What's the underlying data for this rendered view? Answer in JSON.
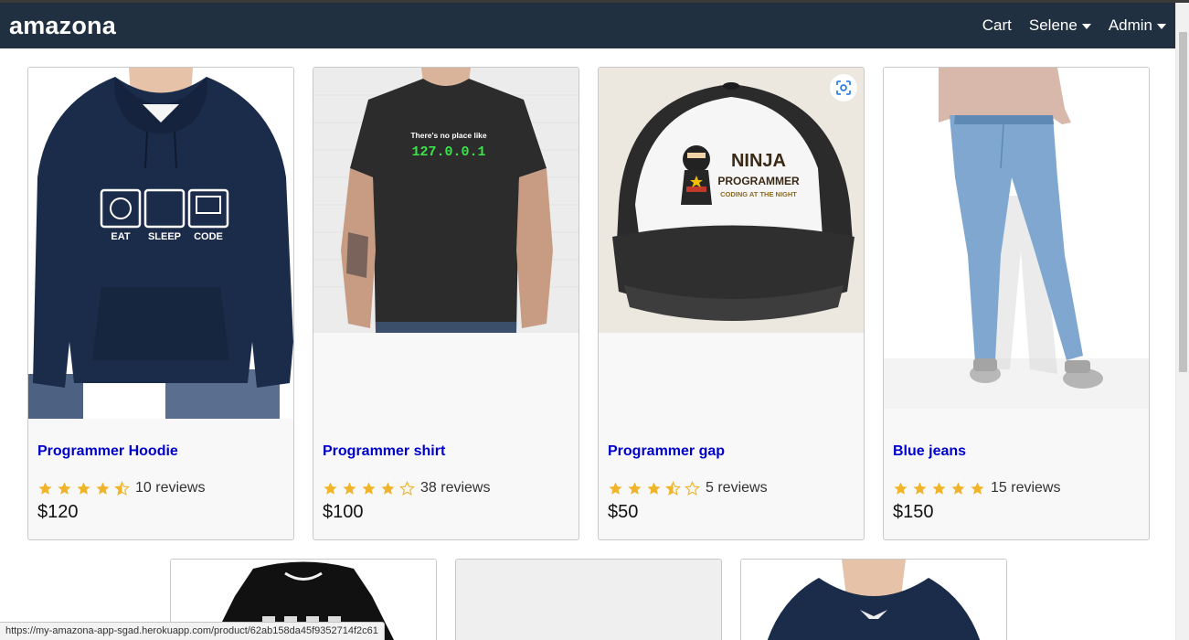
{
  "header": {
    "brand": "amazona",
    "cart_label": "Cart",
    "user_label": "Selene",
    "admin_label": "Admin"
  },
  "colors": {
    "header_bg": "#203040",
    "link": "#0000cc",
    "star": "#f0b429"
  },
  "products": [
    {
      "name": "Programmer Hoodie",
      "rating": 4.5,
      "reviews": "10 reviews",
      "price": "$120"
    },
    {
      "name": "Programmer shirt",
      "rating": 4,
      "reviews": "38 reviews",
      "price": "$100"
    },
    {
      "name": "Programmer gap",
      "rating": 3.5,
      "reviews": "5 reviews",
      "price": "$50"
    },
    {
      "name": "Blue jeans",
      "rating": 5,
      "reviews": "15 reviews",
      "price": "$150"
    }
  ],
  "artwork": {
    "hoodie_labels": [
      "EAT",
      "SLEEP",
      "CODE"
    ],
    "shirt_line1": "There's no place like",
    "shirt_line2": "127.0.0.1",
    "cap_line1": "NINJA",
    "cap_line2": "PROGRAMMER",
    "cap_line3": "CODING AT THE NIGHT"
  },
  "status_url": "https://my-amazona-app-sgad.herokuapp.com/product/62ab158da45f9352714f2c61"
}
